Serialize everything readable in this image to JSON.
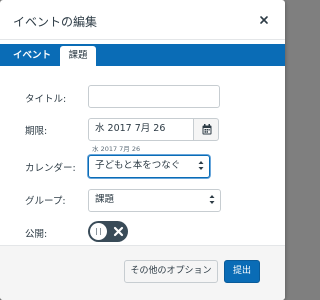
{
  "dialog": {
    "title": "イベントの編集",
    "close_icon": "close-icon"
  },
  "tabs": [
    {
      "label": "イベント",
      "active": false
    },
    {
      "label": "課題",
      "active": true
    }
  ],
  "form": {
    "title_label": "タイトル:",
    "title_value": "",
    "due_label": "期限:",
    "due_value": "水 2017  7月 26",
    "due_hint": "水 2017 7月 26",
    "calendar_icon": "calendar-icon",
    "calendar_label": "カレンダー:",
    "calendar_value": "子どもと本をつなぐ",
    "group_label": "グループ:",
    "group_value": "課題",
    "publish_label": "公開:",
    "publish_enabled": false
  },
  "footer": {
    "more_options_label": "その他のオプション",
    "submit_label": "提出"
  },
  "colors": {
    "brand_blue": "#0a6cb6",
    "toggle_dark": "#394b58",
    "text": "#2d3b45"
  }
}
